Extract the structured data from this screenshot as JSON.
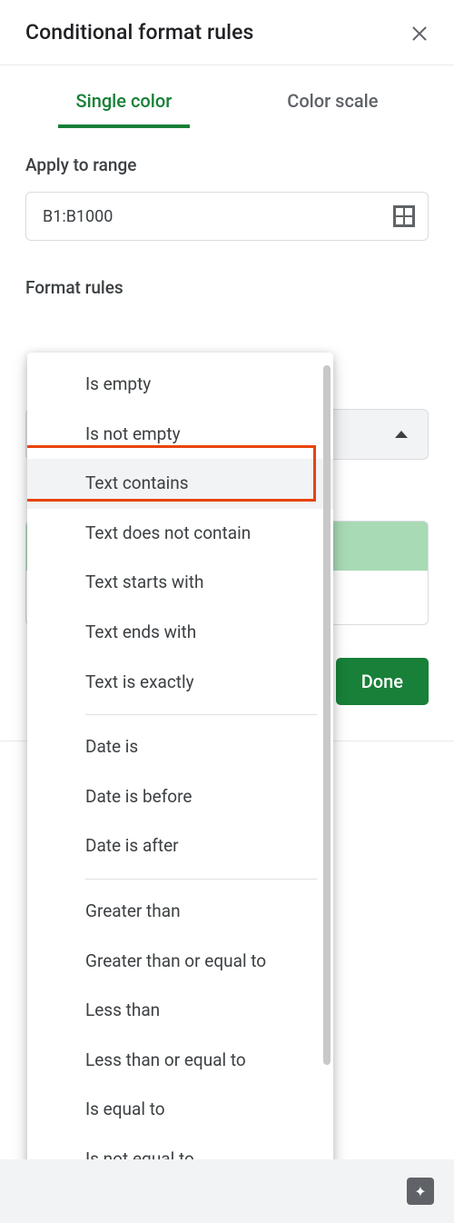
{
  "header": {
    "title": "Conditional format rules"
  },
  "tabs": {
    "single_color": "Single color",
    "color_scale": "Color scale"
  },
  "apply_to_range": {
    "label": "Apply to range",
    "value": "B1:B1000"
  },
  "format_rules": {
    "label": "Format rules"
  },
  "buttons": {
    "done": "Done"
  },
  "dropdown": {
    "selected": "Text contains",
    "groups": [
      {
        "items": [
          "Is empty",
          "Is not empty",
          "Text contains",
          "Text does not contain",
          "Text starts with",
          "Text ends with",
          "Text is exactly"
        ]
      },
      {
        "items": [
          "Date is",
          "Date is before",
          "Date is after"
        ]
      },
      {
        "items": [
          "Greater than",
          "Greater than or equal to",
          "Less than",
          "Less than or equal to",
          "Is equal to",
          "Is not equal to"
        ]
      }
    ]
  }
}
